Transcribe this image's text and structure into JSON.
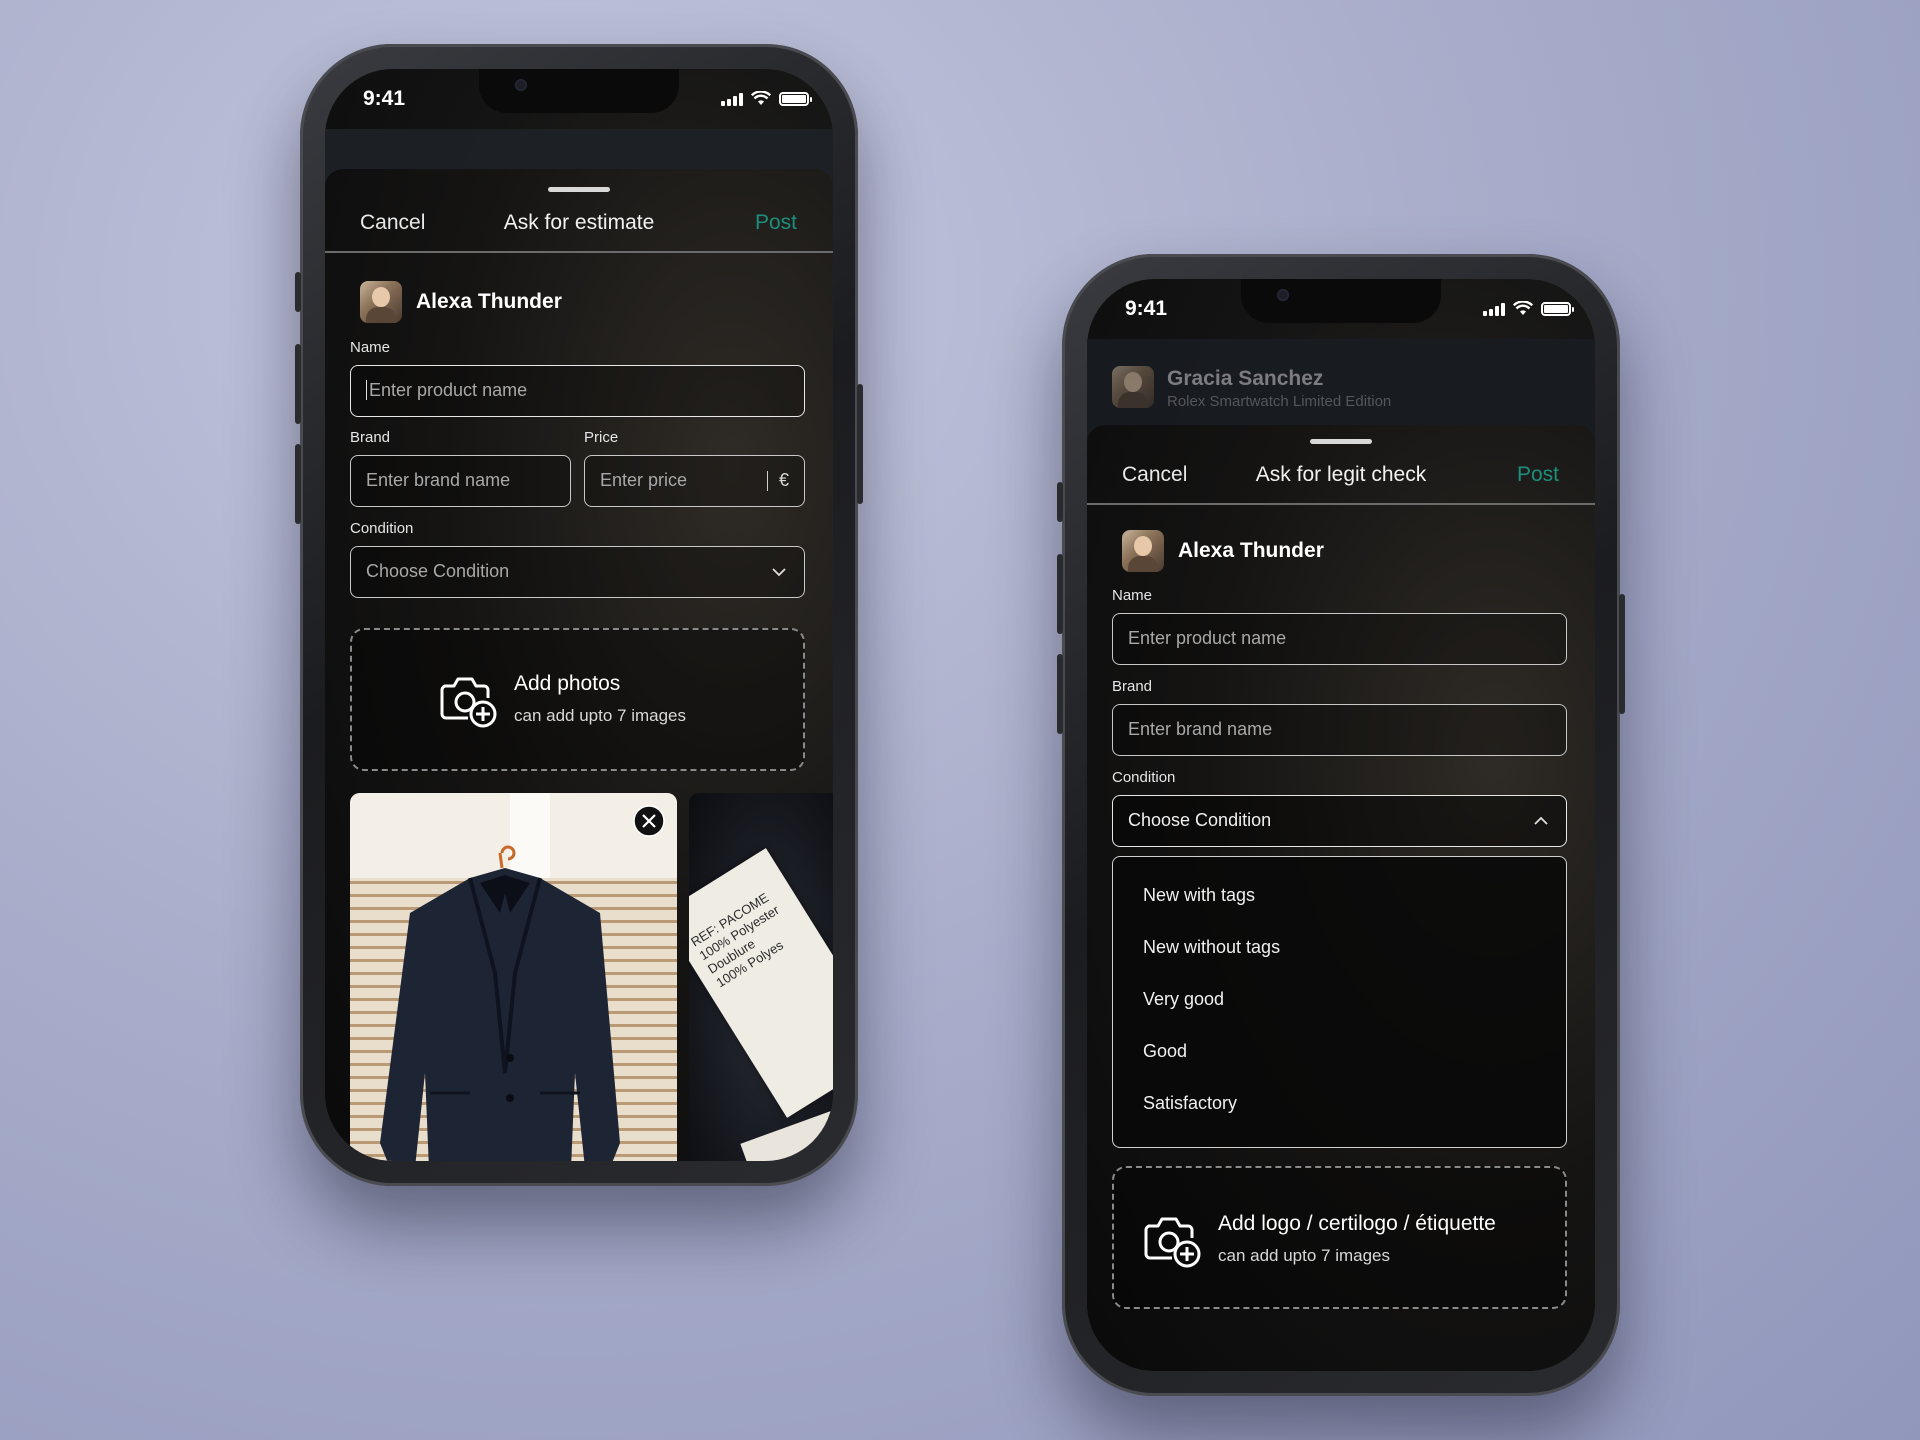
{
  "status": {
    "time": "9:41"
  },
  "left_phone": {
    "nav": {
      "cancel": "Cancel",
      "title": "Ask for estimate",
      "post": "Post"
    },
    "user": {
      "name": "Alexa Thunder"
    },
    "fields": {
      "name_label": "Name",
      "name_placeholder": "Enter product name",
      "brand_label": "Brand",
      "brand_placeholder": "Enter brand name",
      "price_label": "Price",
      "price_placeholder": "Enter price",
      "currency": "€",
      "condition_label": "Condition",
      "condition_placeholder": "Choose Condition"
    },
    "upload": {
      "title": "Add photos",
      "subtitle": "can add upto 7 images"
    },
    "label_photo_text": [
      "REF: PACOME",
      "100% Polyester",
      "Doublure",
      "100% Polyes"
    ]
  },
  "right_phone": {
    "background_post": {
      "user": "Gracia Sanchez",
      "product": "Rolex Smartwatch Limited Edition"
    },
    "nav": {
      "cancel": "Cancel",
      "title": "Ask for legit check",
      "post": "Post"
    },
    "user": {
      "name": "Alexa Thunder"
    },
    "fields": {
      "name_label": "Name",
      "name_placeholder": "Enter product name",
      "brand_label": "Brand",
      "brand_placeholder": "Enter brand name",
      "condition_label": "Condition",
      "condition_value": "Choose Condition"
    },
    "condition_options": [
      "New with tags",
      "New without tags",
      "Very good",
      "Good",
      "Satisfactory"
    ],
    "upload": {
      "title": "Add logo / certilogo / étiquette",
      "subtitle": "can add upto 7 images"
    }
  },
  "colors": {
    "accent": "#1c8f7c",
    "background": "#a9aecb"
  },
  "icons": [
    "camera-plus-icon",
    "chevron-down-icon",
    "chevron-up-icon",
    "close-icon",
    "signal-icon",
    "wifi-icon",
    "battery-icon"
  ]
}
